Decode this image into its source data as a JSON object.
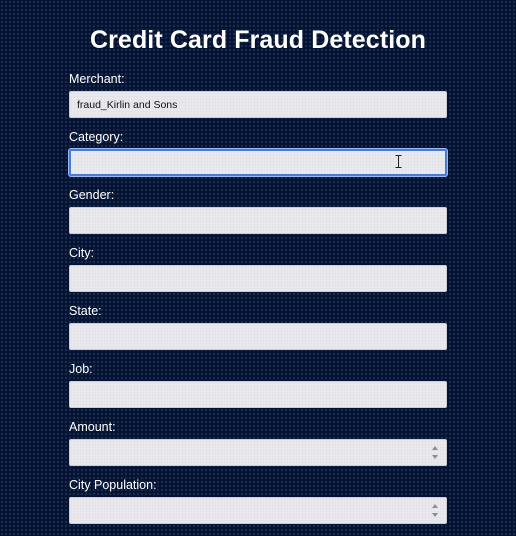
{
  "page": {
    "title": "Credit Card Fraud Detection"
  },
  "form": {
    "fields": [
      {
        "label": "Merchant:",
        "value": "fraud_Kirlin and Sons",
        "type": "text",
        "focused": false
      },
      {
        "label": "Category:",
        "value": "",
        "type": "text",
        "focused": true
      },
      {
        "label": "Gender:",
        "value": "",
        "type": "text",
        "focused": false
      },
      {
        "label": "City:",
        "value": "",
        "type": "text",
        "focused": false
      },
      {
        "label": "State:",
        "value": "",
        "type": "text",
        "focused": false
      },
      {
        "label": "Job:",
        "value": "",
        "type": "text",
        "focused": false
      },
      {
        "label": "Amount:",
        "value": "",
        "type": "number",
        "focused": false
      },
      {
        "label": "City Population:",
        "value": "",
        "type": "number",
        "focused": false
      }
    ]
  },
  "colors": {
    "background": "#061433",
    "focus_ring": "#4a7bd6",
    "input_fill": "#ececf0"
  },
  "icons": {
    "cursor": "text-cursor-icon",
    "spinner": "number-spinner-icon"
  }
}
